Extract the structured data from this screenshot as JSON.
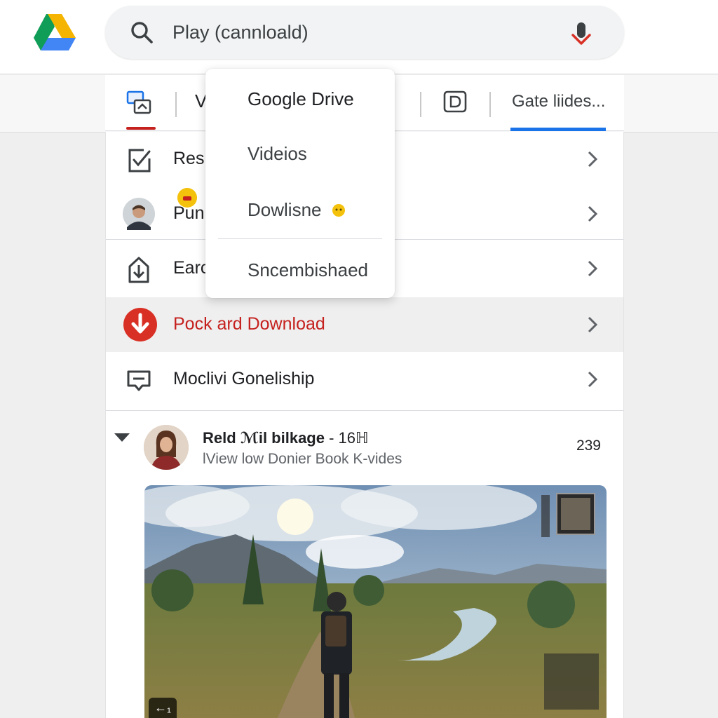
{
  "search": {
    "value": "Play (cannloald)",
    "placeholder": "Search"
  },
  "tabs": {
    "partial_label": "V",
    "right_label": "Gate liides..."
  },
  "list": {
    "items": [
      {
        "label": "Res",
        "icon": "checklist-icon"
      },
      {
        "label": "Pun",
        "icon": "avatar"
      },
      {
        "label": "Earc",
        "icon": "download-file-icon"
      },
      {
        "label": "Pock ard Download",
        "icon": "download-circle-icon"
      },
      {
        "label": "Moclivi Goneliship",
        "icon": "chat-card-icon"
      }
    ]
  },
  "dropdown": {
    "items": [
      "Google Drive",
      "Videios",
      "Dowlisne",
      "Sncembishaed"
    ]
  },
  "feed": {
    "title_bold": "Reld ℳil bilkage",
    "title_rest": " - 16ℍ",
    "subtitle": "lView low Donier Book K-vides",
    "count": "239",
    "overlay_label": "←₁"
  },
  "colors": {
    "accent_red": "#c5221f",
    "accent_blue": "#1a73e8",
    "drive_green": "#0f9d58",
    "drive_yellow": "#f4b400",
    "drive_blue": "#4285f4"
  }
}
